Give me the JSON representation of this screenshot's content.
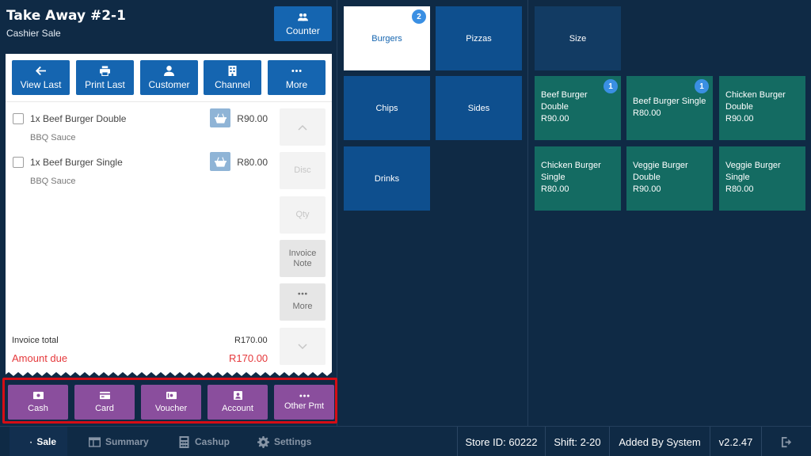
{
  "header": {
    "title": "Take Away #2-1",
    "subtitle": "Cashier Sale",
    "counter_label": "Counter"
  },
  "toolbar": [
    {
      "label": "View Last",
      "icon": "arrow-left-icon"
    },
    {
      "label": "Print Last",
      "icon": "printer-icon"
    },
    {
      "label": "Customer",
      "icon": "person-icon"
    },
    {
      "label": "Channel",
      "icon": "building-icon"
    },
    {
      "label": "More",
      "icon": "dots-icon"
    }
  ],
  "order_items": [
    {
      "name": "1x Beef Burger Double",
      "modifier": "BBQ Sauce",
      "price": "R90.00"
    },
    {
      "name": "1x Beef Burger Single",
      "modifier": "BBQ Sauce",
      "price": "R80.00"
    }
  ],
  "side_actions": {
    "disc": "Disc",
    "qty": "Qty",
    "invoice_note": "Invoice Note",
    "more": "More"
  },
  "totals": {
    "invoice_total_label": "Invoice total",
    "invoice_total": "R170.00",
    "amount_due_label": "Amount due",
    "amount_due": "R170.00"
  },
  "payments": [
    {
      "label": "Cash",
      "icon": "cash-icon"
    },
    {
      "label": "Card",
      "icon": "card-icon"
    },
    {
      "label": "Voucher",
      "icon": "voucher-icon"
    },
    {
      "label": "Account",
      "icon": "account-icon"
    },
    {
      "label": "Other Pmt",
      "icon": "dots-icon"
    }
  ],
  "categories": [
    {
      "label": "Burgers",
      "badge": "2",
      "selected": true
    },
    {
      "label": "Pizzas"
    },
    {
      "label": "Chips"
    },
    {
      "label": "Sides"
    },
    {
      "label": "Drinks"
    }
  ],
  "size_label": "Size",
  "products": [
    {
      "name": "Beef Burger Double",
      "price": "R90.00",
      "badge": "1"
    },
    {
      "name": "Beef Burger Single",
      "price": "R80.00",
      "badge": "1"
    },
    {
      "name": "Chicken Burger Double",
      "price": "R90.00"
    },
    {
      "name": "Chicken Burger Single",
      "price": "R80.00"
    },
    {
      "name": "Veggie Burger Double",
      "price": "R90.00"
    },
    {
      "name": "Veggie Burger Single",
      "price": "R80.00"
    }
  ],
  "nav": {
    "sale": "Sale",
    "summary": "Summary",
    "cashup": "Cashup",
    "settings": "Settings"
  },
  "status": {
    "store": "Store ID: 60222",
    "shift": "Shift: 2-20",
    "added_by": "Added By System",
    "version": "v2.2.47"
  },
  "colors": {
    "background": "#0f2a45",
    "primary_button": "#1565b0",
    "category": "#0e4f8e",
    "product": "#146b62",
    "payment": "#8a4e9d",
    "amount_due": "#e5383b",
    "highlight_border": "#d50d15"
  }
}
